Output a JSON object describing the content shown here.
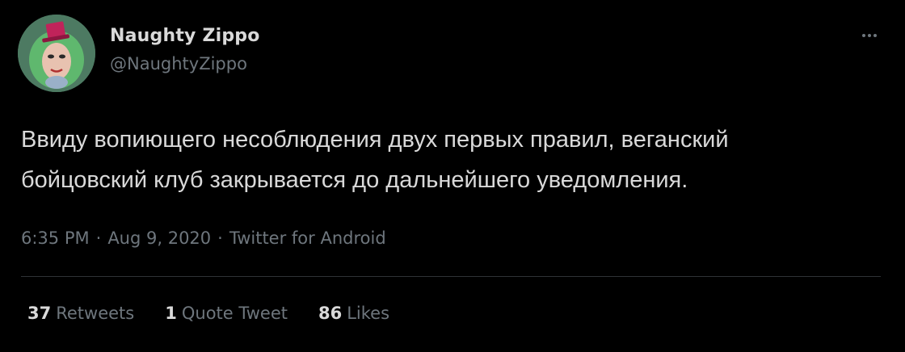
{
  "author": {
    "name": "Naughty Zippo",
    "handle": "@NaughtyZippo"
  },
  "tweet": {
    "text_line1": "Ввиду вопиющего несоблюдения двух первых правил, веганский",
    "text_line2": "бойцовский клуб закрывается до дальнейшего уведомления.",
    "time": "6:35 PM",
    "date": "Aug 9, 2020",
    "source": "Twitter for Android"
  },
  "stats": {
    "retweets_count": "37",
    "retweets_label": "Retweets",
    "quotes_count": "1",
    "quotes_label": "Quote Tweet",
    "likes_count": "86",
    "likes_label": "Likes"
  },
  "icons": {
    "more": "more-horizontal-icon"
  },
  "colors": {
    "background": "#000000",
    "primary_text": "#d9d9d9",
    "secondary_text": "#6e767d",
    "divider": "#2f3336"
  }
}
